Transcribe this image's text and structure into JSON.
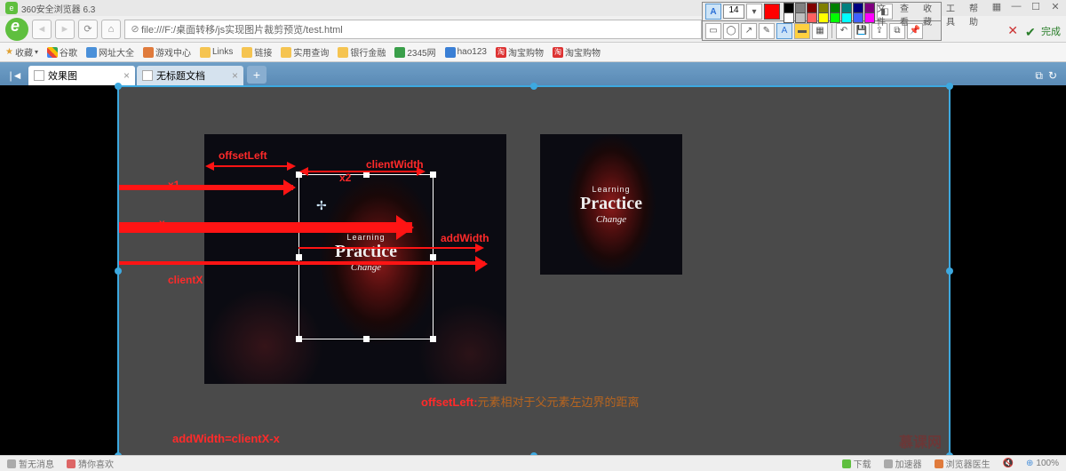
{
  "title_bar": {
    "app_title": "360安全浏览器 6.3"
  },
  "win_menu": {
    "file": "文件",
    "view": "查看",
    "fav": "收藏",
    "tools": "工具",
    "help": "帮助"
  },
  "addr": {
    "url": "file:///F:/桌面转移/js实现图片裁剪预览/test.html",
    "scheme_icon": "⊘"
  },
  "bookmarks": {
    "fav_label": "收藏",
    "items": [
      "谷歌",
      "网址大全",
      "游戏中心",
      "Links",
      "链接",
      "实用查询",
      "银行金融",
      "2345网",
      "hao123",
      "淘宝购物",
      "淘宝购物"
    ]
  },
  "tabs": {
    "t1": "效果图",
    "t2": "无标题文档",
    "add": "+"
  },
  "anno_toolbar": {
    "font_size": "14",
    "letter": "A",
    "colors_row1": [
      "#ff0000",
      "#808080",
      "#800000",
      "#808000",
      "#008000",
      "#008080",
      "#000080",
      "#800080"
    ],
    "colors_row2": [
      "#ffffff",
      "#c0c0c0",
      "#ff8080",
      "#ffff00",
      "#00ff00",
      "#00ffff",
      "#0000ff",
      "#ff00ff"
    ],
    "selected_color": "#ff0000",
    "done": "完成"
  },
  "labels": {
    "offsetLeft": "offsetLeft",
    "clientWidth": "clientWidth",
    "x1": "x1",
    "x2": "x2",
    "x": "x",
    "addWidth": "addWidth",
    "clientX": "clientX",
    "formula": "addWidth=clientX-x",
    "explain_key": "offsetLeft:",
    "explain_val": "元素相对于父元素左边界的距离"
  },
  "practice": {
    "l1": "Learning",
    "l2": "Practice",
    "l3": "Change"
  },
  "status": {
    "left1": "暂无消息",
    "left2": "猜你喜欢",
    "dl": "下载",
    "med": "加速器",
    "doc": "浏览器医生",
    "zoom": "100%"
  },
  "watermark": "慕课网"
}
